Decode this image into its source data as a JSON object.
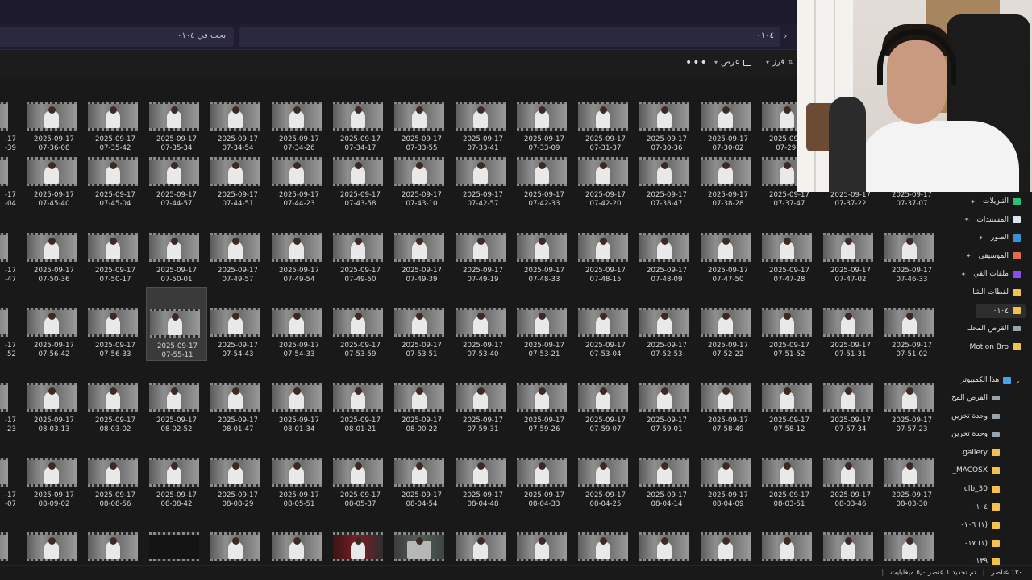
{
  "titlebar": {
    "minimize_icon": "minimize-icon"
  },
  "addressbar": {
    "path": "٠١٠٤",
    "search_placeholder": "بحث في ٠١٠٤",
    "chevron_icon": "chevron-right-icon"
  },
  "commandbar": {
    "more_label": "•••",
    "view_label": "عرض",
    "sort_label": "فرز"
  },
  "file_rows": [
    [
      "2025-09-17\n07-36-08",
      "2025-09-17\n07-35-42",
      "2025-09-17\n07-35-34",
      "2025-09-17\n07-34-54",
      "2025-09-17\n07-34-26",
      "2025-09-17\n07-34-17",
      "2025-09-17\n07-33-55",
      "2025-09-17\n07-33-41",
      "2025-09-17\n07-33-09",
      "2025-09-17\n07-31-37",
      "2025-09-17\n07-30-36",
      "2025-09-17\n07-30-02",
      "2025-09-17\n07-29-2"
    ],
    [
      "2025-09-17\n07-45-40",
      "2025-09-17\n07-45-04",
      "2025-09-17\n07-44-57",
      "2025-09-17\n07-44-51",
      "2025-09-17\n07-44-23",
      "2025-09-17\n07-43-58",
      "2025-09-17\n07-43-10",
      "2025-09-17\n07-42-57",
      "2025-09-17\n07-42-33",
      "2025-09-17\n07-42-20",
      "2025-09-17\n07-38-47",
      "2025-09-17\n07-38-28",
      "2025-09-17\n07-37-47",
      "2025-09-17\n07-37-22",
      "2025-09-17\n07-37-07"
    ],
    [
      "2025-09-17\n07-50-36",
      "2025-09-17\n07-50-17",
      "2025-09-17\n07-50-01",
      "2025-09-17\n07-49-57",
      "2025-09-17\n07-49-54",
      "2025-09-17\n07-49-50",
      "2025-09-17\n07-49-39",
      "2025-09-17\n07-49-19",
      "2025-09-17\n07-48-33",
      "2025-09-17\n07-48-15",
      "2025-09-17\n07-48-09",
      "2025-09-17\n07-47-50",
      "2025-09-17\n07-47-28",
      "2025-09-17\n07-47-02",
      "2025-09-17\n07-46-33"
    ],
    [
      "2025-09-17\n07-56-42",
      "2025-09-17\n07-56-33",
      "2025-09-17\n07-55-11",
      "2025-09-17\n07-54-43",
      "2025-09-17\n07-54-33",
      "2025-09-17\n07-53-59",
      "2025-09-17\n07-53-51",
      "2025-09-17\n07-53-40",
      "2025-09-17\n07-53-21",
      "2025-09-17\n07-53-04",
      "2025-09-17\n07-52-53",
      "2025-09-17\n07-52-22",
      "2025-09-17\n07-51-52",
      "2025-09-17\n07-51-31",
      "2025-09-17\n07-51-02"
    ],
    [
      "2025-09-17\n08-03-13",
      "2025-09-17\n08-03-02",
      "2025-09-17\n08-02-52",
      "2025-09-17\n08-01-47",
      "2025-09-17\n08-01-34",
      "2025-09-17\n08-01-21",
      "2025-09-17\n08-00-22",
      "2025-09-17\n07-59-31",
      "2025-09-17\n07-59-26",
      "2025-09-17\n07-59-07",
      "2025-09-17\n07-59-01",
      "2025-09-17\n07-58-49",
      "2025-09-17\n07-58-12",
      "2025-09-17\n07-57-34",
      "2025-09-17\n07-57-23"
    ],
    [
      "2025-09-17\n08-09-02",
      "2025-09-17\n08-08-56",
      "2025-09-17\n08-08-42",
      "2025-09-17\n08-08-29",
      "2025-09-17\n08-05-51",
      "2025-09-17\n08-05-37",
      "2025-09-17\n08-04-54",
      "2025-09-17\n08-04-48",
      "2025-09-17\n08-04-33",
      "2025-09-17\n08-04-25",
      "2025-09-17\n08-04-14",
      "2025-09-17\n08-04-09",
      "2025-09-17\n08-03-51",
      "2025-09-17\n08-03-46",
      "2025-09-17\n08-03-30"
    ],
    [
      "",
      "",
      "",
      "",
      "",
      "",
      "",
      "",
      "",
      "",
      "",
      "",
      "",
      "",
      ""
    ]
  ],
  "left_edge_captions": [
    "-17\n-39",
    "-17\n-04",
    "-17\n-47",
    "-17\n-52",
    "-17\n-23",
    "-17\n-07",
    ""
  ],
  "selected_item": {
    "row": 3,
    "col": 2
  },
  "sidebar": {
    "items": [
      {
        "label": "التنزيلات",
        "icon": "download-icon",
        "pinned": true
      },
      {
        "label": "المستندات",
        "icon": "document-icon",
        "pinned": true
      },
      {
        "label": "الصور",
        "icon": "picture-icon",
        "pinned": true
      },
      {
        "label": "الموسيقى",
        "icon": "music-icon",
        "pinned": true
      },
      {
        "label": "ملفات الفي",
        "icon": "video-icon",
        "pinned": true
      },
      {
        "label": "لقطات الشا",
        "icon": "folder-icon",
        "pinned": false
      },
      {
        "label": "٠١٠٤",
        "icon": "folder-icon",
        "pinned": false
      },
      {
        "label": "القرص المحلـ",
        "icon": "drive-icon",
        "pinned": false
      },
      {
        "label": "Motion Bro",
        "icon": "folder-icon",
        "pinned": false
      }
    ],
    "this_pc": {
      "label": "هذا الكمبيوتر",
      "icon": "pc-icon"
    },
    "pc_items": [
      {
        "label": "القرص المح",
        "icon": "drive-icon"
      },
      {
        "label": "وحدة تخزين",
        "icon": "drive-icon"
      },
      {
        "label": "وحدة تخزين",
        "icon": "drive-icon"
      },
      {
        "label": "gallery.",
        "icon": "folder-icon"
      },
      {
        "label": "MACOSX_",
        "icon": "folder-icon"
      },
      {
        "label": "‪clb_30",
        "icon": "folder-icon"
      },
      {
        "label": "٠١٠٤",
        "icon": "folder-icon"
      },
      {
        "label": "(١) ٠١٠٦",
        "icon": "folder-icon"
      },
      {
        "label": "(١) ٠١٧",
        "icon": "folder-icon"
      },
      {
        "label": "٠١٣٩",
        "icon": "folder-icon"
      }
    ]
  },
  "statusbar": {
    "count": "١٣٠ عناصر",
    "selection": "تم تحديد ١ عنصر ٥٫٠ ميغابايت"
  }
}
